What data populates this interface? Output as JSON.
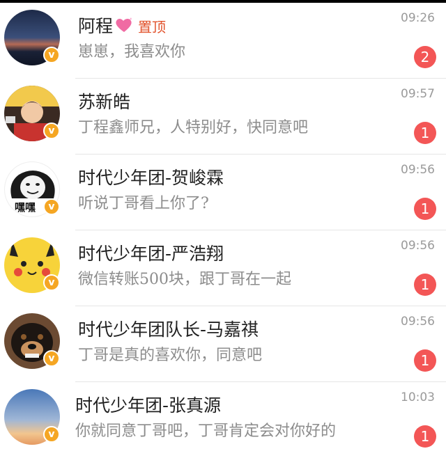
{
  "chats": [
    {
      "name": "阿程",
      "pinned_label": "置顶",
      "time": "09:26",
      "message": "崽崽，我喜欢你",
      "unread": "2",
      "avatar": "night-sky-avatar",
      "verified": "v"
    },
    {
      "name": "苏新皓",
      "time": "09:57",
      "message": "丁程鑫师兄，人特别好，快同意吧",
      "unread": "1",
      "avatar": "boy-cartoon-avatar",
      "verified": "v"
    },
    {
      "name": "时代少年团-贺峻霖",
      "time": "09:56",
      "message": "听说丁哥看上你了?",
      "unread": "1",
      "avatar": "meme-face-avatar",
      "avatar_text": "嘿嘿",
      "verified": "v"
    },
    {
      "name": "时代少年团-严浩翔",
      "time": "09:56",
      "message": "微信转账500块，跟丁哥在一起",
      "unread": "1",
      "avatar": "pikachu-avatar",
      "verified": "v"
    },
    {
      "name": "时代少年团队长-马嘉祺",
      "time": "09:56",
      "message": "丁哥是真的喜欢你，同意吧",
      "unread": "1",
      "avatar": "dog-avatar",
      "verified": "v"
    },
    {
      "name": "时代少年团-张真源",
      "time": "10:03",
      "message": "你就同意丁哥吧，丁哥肯定会对你好的",
      "unread": "1",
      "avatar": "sunset-sky-avatar",
      "verified": "v"
    }
  ],
  "colors": {
    "badge": "#f35656",
    "verified": "#f5a623",
    "pin": "#e2532c"
  }
}
